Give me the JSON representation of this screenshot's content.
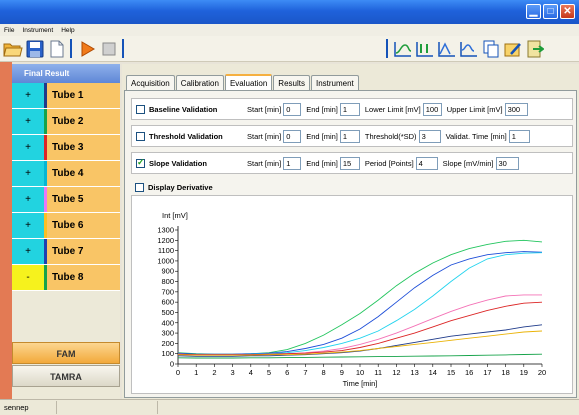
{
  "menu": [
    "File",
    "Instrument",
    "Help"
  ],
  "sidebar": {
    "header": "Final Result",
    "tubes": [
      {
        "sign": "+",
        "label": "Tube 1",
        "sign_color": "#22d3e0",
        "bar_color": "#1e3a8a"
      },
      {
        "sign": "+",
        "label": "Tube 2",
        "sign_color": "#22d3e0",
        "bar_color": "#16a34a"
      },
      {
        "sign": "+",
        "label": "Tube 3",
        "sign_color": "#22d3e0",
        "bar_color": "#dc2626"
      },
      {
        "sign": "+",
        "label": "Tube 4",
        "sign_color": "#22d3e0",
        "bar_color": "#06b6d4"
      },
      {
        "sign": "+",
        "label": "Tube 5",
        "sign_color": "#22d3e0",
        "bar_color": "#e879f9"
      },
      {
        "sign": "+",
        "label": "Tube 6",
        "sign_color": "#22d3e0",
        "bar_color": "#fbbf24"
      },
      {
        "sign": "+",
        "label": "Tube 7",
        "sign_color": "#22d3e0",
        "bar_color": "#1e40af"
      },
      {
        "sign": "-",
        "label": "Tube 8",
        "sign_color": "#f6f21d",
        "bar_color": "#16a34a"
      }
    ],
    "dye_buttons": [
      "FAM",
      "TAMRA"
    ]
  },
  "tabs": [
    "Acquisition",
    "Calibration",
    "Evaluation",
    "Results",
    "Instrument"
  ],
  "active_tab": "Evaluation",
  "validations": [
    {
      "label": "Baseline Validation",
      "checked": false,
      "fields": [
        {
          "label": "Start [min]",
          "value": "0"
        },
        {
          "label": "End [min]",
          "value": "1"
        },
        {
          "label": "Lower Limit [mV]",
          "value": "100"
        },
        {
          "label": "Upper Limit [mV]",
          "value": "300"
        }
      ]
    },
    {
      "label": "Threshold Validation",
      "checked": false,
      "fields": [
        {
          "label": "Start [min]",
          "value": "0"
        },
        {
          "label": "End [min]",
          "value": "1"
        },
        {
          "label": "Threshold(*SD)",
          "value": "3"
        },
        {
          "label": "Validat. Time [min]",
          "value": "1"
        }
      ]
    },
    {
      "label": "Slope Validation",
      "checked": true,
      "fields": [
        {
          "label": "Start [min]",
          "value": "1"
        },
        {
          "label": "End [min]",
          "value": "15"
        },
        {
          "label": "Period [Points]",
          "value": "4"
        },
        {
          "label": "Slope [mV/min]",
          "value": "30"
        }
      ]
    }
  ],
  "display_derivative": {
    "label": "Display Derivative",
    "checked": false
  },
  "status": {
    "text": "sennep"
  },
  "chart_data": {
    "type": "line",
    "ylabel": "Int [mV]",
    "xlabel": "Time [min]",
    "xlim": [
      0,
      20
    ],
    "ylim": [
      0,
      1300
    ],
    "xticks": [
      0,
      1,
      2,
      3,
      4,
      5,
      6,
      7,
      8,
      9,
      10,
      11,
      12,
      13,
      14,
      15,
      16,
      17,
      18,
      19,
      20
    ],
    "yticks": [
      0,
      100,
      200,
      300,
      400,
      500,
      600,
      700,
      800,
      900,
      1000,
      1100,
      1200,
      1300
    ],
    "x": [
      0,
      1,
      2,
      3,
      4,
      5,
      6,
      7,
      8,
      9,
      10,
      11,
      12,
      13,
      14,
      15,
      16,
      17,
      18,
      19,
      20
    ],
    "series": [
      {
        "color": "#22c55e",
        "values": [
          110,
          100,
          95,
          95,
          100,
          110,
          140,
          200,
          280,
          380,
          490,
          620,
          760,
          880,
          980,
          1060,
          1120,
          1160,
          1190,
          1200,
          1185
        ]
      },
      {
        "color": "#1d4ed8",
        "values": [
          105,
          95,
          95,
          95,
          100,
          105,
          120,
          150,
          190,
          250,
          340,
          460,
          600,
          740,
          860,
          960,
          1020,
          1060,
          1080,
          1090,
          1085
        ]
      },
      {
        "color": "#22d3ee",
        "values": [
          95,
          90,
          90,
          90,
          95,
          100,
          110,
          130,
          160,
          200,
          250,
          320,
          420,
          530,
          660,
          800,
          930,
          1020,
          1060,
          1075,
          1080
        ]
      },
      {
        "color": "#f472b6",
        "values": [
          95,
          90,
          90,
          90,
          90,
          95,
          100,
          110,
          125,
          150,
          190,
          240,
          300,
          370,
          440,
          510,
          570,
          620,
          660,
          670,
          670
        ]
      },
      {
        "color": "#dc2626",
        "values": [
          95,
          90,
          90,
          90,
          90,
          95,
          100,
          105,
          115,
          130,
          160,
          200,
          250,
          300,
          360,
          420,
          470,
          520,
          560,
          590,
          600
        ]
      },
      {
        "color": "#1e3a8a",
        "values": [
          80,
          75,
          75,
          75,
          80,
          80,
          85,
          90,
          100,
          110,
          125,
          150,
          180,
          210,
          240,
          270,
          290,
          310,
          330,
          360,
          380
        ]
      },
      {
        "color": "#eab308",
        "values": [
          90,
          85,
          85,
          85,
          85,
          90,
          90,
          95,
          105,
          115,
          130,
          150,
          170,
          190,
          210,
          230,
          250,
          270,
          290,
          310,
          320
        ]
      },
      {
        "color": "#16a34a",
        "values": [
          60,
          58,
          58,
          58,
          60,
          60,
          62,
          64,
          66,
          68,
          70,
          72,
          74,
          76,
          78,
          80,
          82,
          85,
          88,
          92,
          95
        ]
      }
    ]
  }
}
